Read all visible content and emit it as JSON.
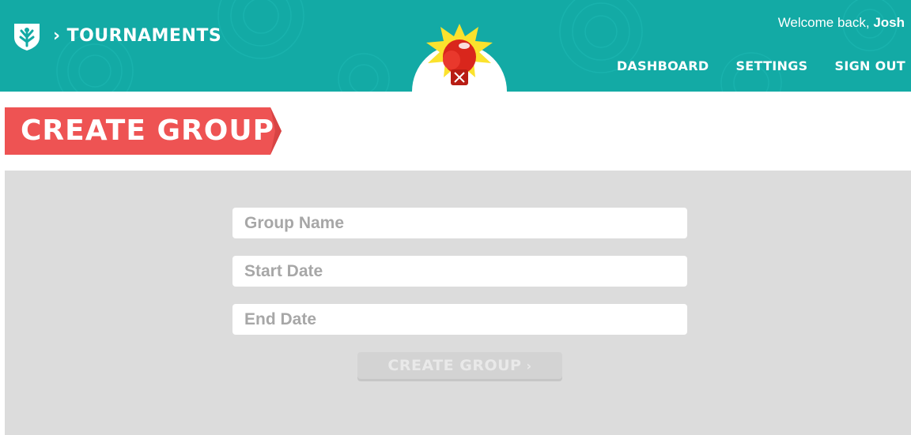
{
  "header": {
    "breadcrumb_arrow": "›",
    "breadcrumb_label": "TOURNAMENTS",
    "welcome_prefix": "Welcome back, ",
    "user_name": "Josh",
    "nav": {
      "dashboard": "DASHBOARD",
      "settings": "SETTINGS",
      "sign_out": "SIGN OUT"
    },
    "logo_icon": "shield-leaf-icon",
    "mascot_icon": "boxing-glove-icon"
  },
  "page": {
    "title": "CREATE GROUP"
  },
  "form": {
    "group_name_placeholder": "Group Name",
    "start_date_placeholder": "Start Date",
    "end_date_placeholder": "End Date",
    "submit_label": "CREATE GROUP",
    "submit_arrow": "›"
  },
  "colors": {
    "header": "#13aaa5",
    "banner": "#ee5353",
    "panel": "#dcdcdc",
    "star": "#fbe22d",
    "glove": "#d9261c"
  }
}
